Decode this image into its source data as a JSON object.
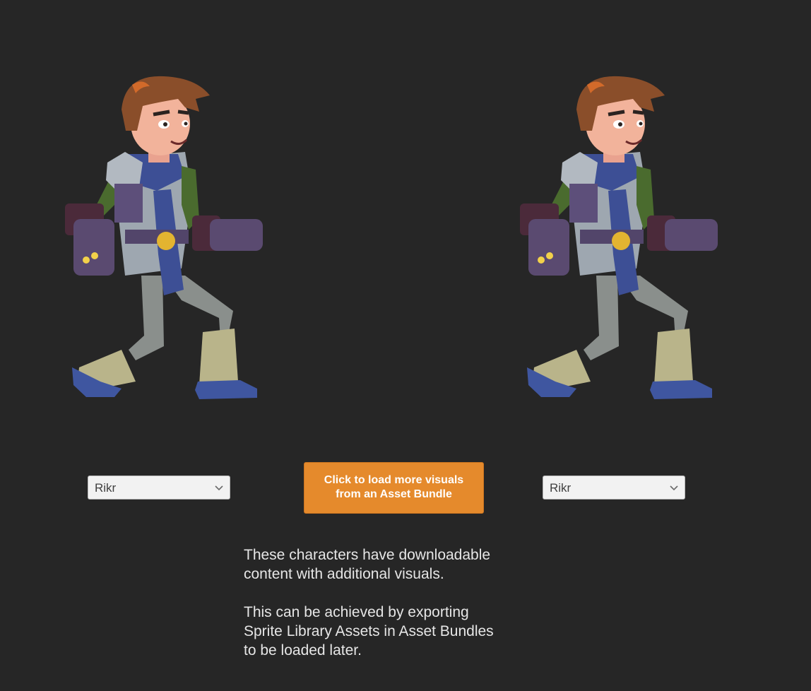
{
  "characters": [
    {
      "id": "left",
      "icon": "character-sprite"
    },
    {
      "id": "right",
      "icon": "character-sprite"
    }
  ],
  "dropdown_left": {
    "selected": "Rikr"
  },
  "dropdown_right": {
    "selected": "Rikr"
  },
  "load_button": {
    "line1": "Click to load more visuals",
    "line2": "from an Asset Bundle"
  },
  "info": {
    "paragraph1": [
      "These characters have downloadable",
      "content with additional visuals."
    ],
    "paragraph2": [
      "This can be achieved by exporting",
      "Sprite Library Assets in Asset Bundles",
      "to be loaded later."
    ]
  },
  "colors": {
    "background": "#262626",
    "button": "#e58a2c",
    "text": "#e6e6e6",
    "dropdown_bg": "#f2f2f2"
  }
}
